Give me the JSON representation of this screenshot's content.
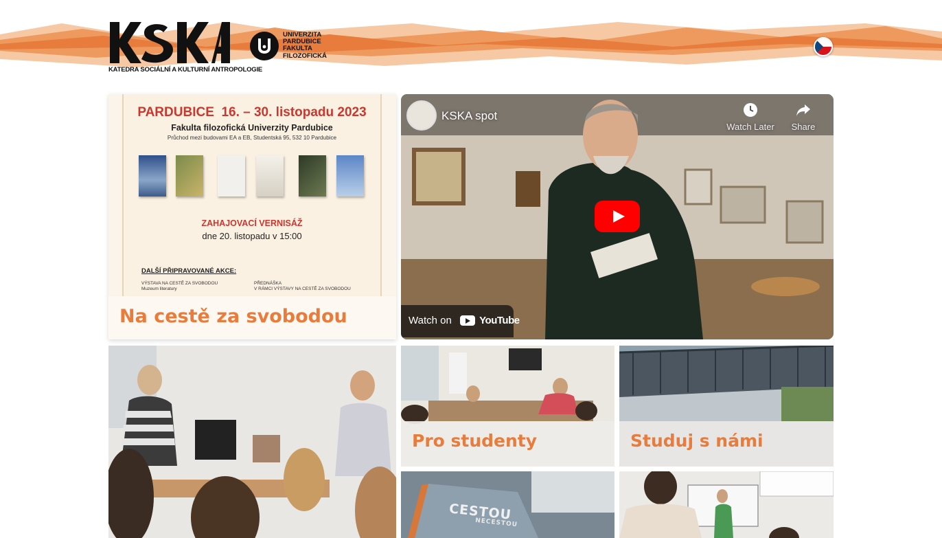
{
  "header": {
    "logo_text": "KSKA",
    "logo_subtitle": "KATEDRA SOCIÁLNÍ A KULTURNÍ ANTROPOLOGIE",
    "university_lines": [
      "UNIVERZITA",
      "PARDUBICE",
      "FAKULTA",
      "FILOZOFICKÁ"
    ],
    "language_icon": "czech-flag-icon"
  },
  "poster": {
    "title_city": "PARDUBICE",
    "title_dates": "16. – 30. listopadu 2023",
    "subtitle": "Fakulta filozofická Univerzity Pardubice",
    "address": "Průchod mezi budovami EA a EB, Studentská 95, 532 10 Pardubice",
    "vernisaz": "ZAHAJOVACÍ VERNISÁŽ",
    "vernisaz_date": "dne 20. listopadu v 15:00",
    "dalsi": "DALŠÍ PŘIPRAVOVANÉ AKCE:",
    "left_small": "VÝSTAVA NA CESTĚ ZA SVOBODOU\nMuzeum literatury",
    "right_small": "PŘEDNÁŠKA\nV RÁMCI VÝSTAVY NA CESTĚ ZA SVOBODOU",
    "label": "Na cestě za svobodou"
  },
  "video": {
    "title": "KSKA spot",
    "watch_later": "Watch Later",
    "share": "Share",
    "watch_on": "Watch on",
    "youtube": "YouTube"
  },
  "tiles": {
    "students_label": "Pro studenty",
    "studuj_label": "Studuj s námi",
    "book_title": "CESTOU",
    "book_subtitle": "NECESTOU"
  },
  "colors": {
    "accent_orange": "#e77c3c",
    "poster_red": "#c9372e",
    "youtube_red": "#ff0000"
  }
}
